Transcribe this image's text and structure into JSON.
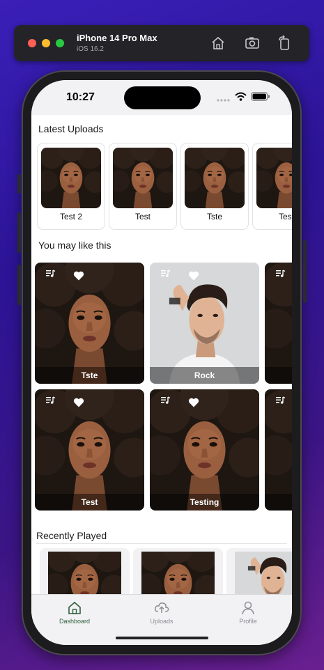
{
  "simulator": {
    "device": "iPhone 14 Pro Max",
    "os": "iOS 16.2",
    "icons": [
      "home-icon",
      "screenshot-icon",
      "rotate-icon"
    ]
  },
  "status_bar": {
    "time": "10:27",
    "icons": [
      "signal-icon",
      "wifi-icon",
      "battery-icon"
    ]
  },
  "latest_uploads": {
    "title": "Latest Uploads",
    "items": [
      {
        "label": "Test 2",
        "image": "woman-portrait"
      },
      {
        "label": "Test",
        "image": "woman-portrait"
      },
      {
        "label": "Tste",
        "image": "woman-portrait"
      },
      {
        "label": "Test",
        "image": "woman-portrait"
      }
    ]
  },
  "you_may_like": {
    "title": "You may like this",
    "rows": [
      [
        {
          "label": "Tste",
          "image": "woman-portrait"
        },
        {
          "label": "Rock",
          "image": "man-portrait"
        },
        {
          "label": "",
          "image": "woman-portrait"
        }
      ],
      [
        {
          "label": "Test",
          "image": "woman-portrait"
        },
        {
          "label": "Testing",
          "image": "woman-portrait"
        },
        {
          "label": "",
          "image": "woman-portrait"
        }
      ]
    ],
    "icons": [
      "playlist-icon",
      "heart-icon"
    ]
  },
  "recently_played": {
    "title": "Recently Played",
    "items": [
      {
        "image": "woman-portrait"
      },
      {
        "image": "woman-portrait"
      },
      {
        "image": "man-portrait"
      }
    ]
  },
  "tab_bar": {
    "tabs": [
      {
        "label": "Dashboard",
        "icon": "home-icon",
        "active": true
      },
      {
        "label": "Uploads",
        "icon": "cloud-upload-icon",
        "active": false
      },
      {
        "label": "Profile",
        "icon": "person-icon",
        "active": false
      }
    ],
    "active_color": "#2e5e3a",
    "inactive_color": "#8e8e93"
  }
}
